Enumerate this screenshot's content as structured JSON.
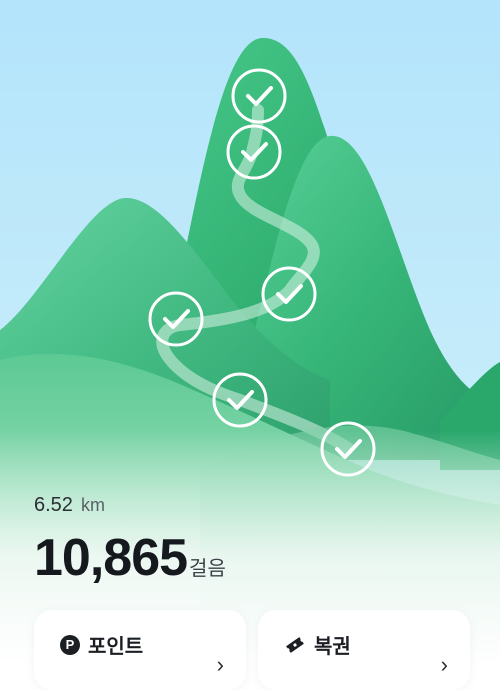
{
  "trail": {
    "checkpoints": [
      {
        "id": 1,
        "status": "completed",
        "icon": "check-icon"
      },
      {
        "id": 2,
        "status": "completed",
        "icon": "check-icon"
      },
      {
        "id": 3,
        "status": "completed",
        "icon": "check-icon"
      },
      {
        "id": 4,
        "status": "completed",
        "icon": "check-icon"
      },
      {
        "id": 5,
        "status": "completed",
        "icon": "check-icon"
      },
      {
        "id": 6,
        "status": "completed",
        "icon": "check-icon"
      }
    ]
  },
  "stats": {
    "distance_value": "6.52",
    "distance_unit": "km",
    "steps_value": "10,865",
    "steps_unit": "걸음"
  },
  "cards": {
    "points_label": "포인트",
    "points_icon": "P",
    "tickets_label": "복권"
  },
  "colors": {
    "sky": "#b7e6fb",
    "mountain": "#34b779",
    "text_primary": "#15191e"
  }
}
